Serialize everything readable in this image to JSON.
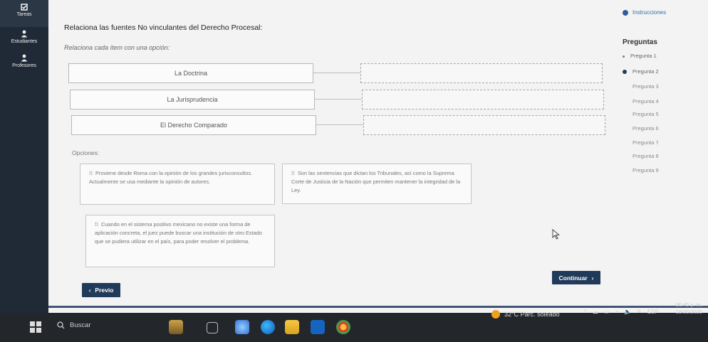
{
  "sidebar": {
    "items": [
      {
        "label": "Tareas",
        "icon": "checkbox-icon"
      },
      {
        "label": "Estudiantes",
        "icon": "person-icon"
      },
      {
        "label": "Profesores",
        "icon": "person-icon"
      }
    ]
  },
  "main": {
    "title": "Relaciona las fuentes No vinculantes del Derecho Procesal:",
    "subtitle": "Relaciona cada ítem con una opción:",
    "terms": [
      "La Doctrina",
      "La Jurisprudencia",
      "El Derecho Comparado"
    ],
    "options_label": "Opciones:",
    "options": [
      "Proviene desde Roma con la opinión de los grandes jurisconsultos. Actualmente se usa mediante la opinión de autores.",
      "Son las sentencias que dictan los Tribunales, así como la Suprema Corte de Justicia de la Nación que permiten mantener la integridad de la Ley.",
      "Cuando en el sistema positivo mexicano no existe una forma de aplicación concreta, el juez puede buscar una institución de otro Estado que se pudiera utilizar en el país, para poder resolver el problema."
    ],
    "prev_label": "Previo",
    "next_label": "Continuar"
  },
  "questions": {
    "instructions_label": "Instrucciones",
    "heading": "Preguntas",
    "items": [
      "Pregunta 1",
      "Pregunta 2",
      "Pregunta 3",
      "Pregunta 4",
      "Pregunta 5",
      "Pregunta 6",
      "Pregunta 7",
      "Pregunta 8",
      "Pregunta 9"
    ]
  },
  "taskbar": {
    "search_placeholder": "Buscar",
    "weather": "32°C  Parc. soleado",
    "lang": "ESP",
    "time": "06:45 p. m.",
    "date": "18/05/2025"
  },
  "colors": {
    "sidebar": "#1f2a36",
    "accent": "#203a5a",
    "link": "#3a6fa8"
  }
}
